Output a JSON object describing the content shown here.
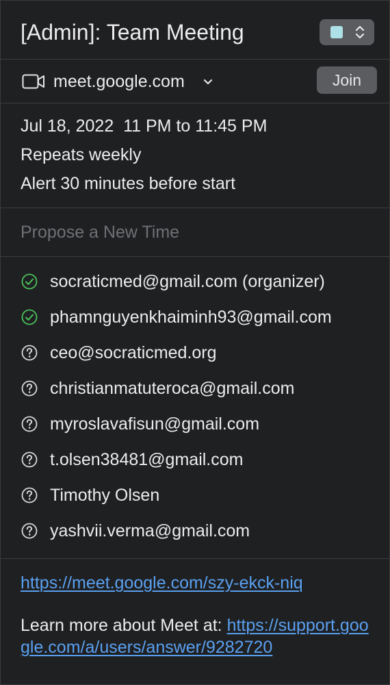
{
  "event": {
    "title": "[Admin]: Team Meeting",
    "calendar_color": "#aee0e7"
  },
  "conferencing": {
    "service_label": "meet.google.com",
    "join_label": "Join",
    "icon": "video-camera-icon"
  },
  "details": {
    "datetime": "Jul 18, 2022  11 PM to 11:45 PM",
    "recurrence": "Repeats weekly",
    "alert": "Alert 30 minutes before start"
  },
  "propose_placeholder": "Propose a New Time",
  "attendees": [
    {
      "name": "socraticmed@gmail.com (organizer)",
      "status": "accepted",
      "icon": "check-circle-icon"
    },
    {
      "name": "phamnguyenkhaiminh93@gmail.com",
      "status": "accepted",
      "icon": "check-circle-icon"
    },
    {
      "name": "ceo@socraticmed.org",
      "status": "unknown",
      "icon": "question-circle-icon"
    },
    {
      "name": "christianmatuteroca@gmail.com",
      "status": "unknown",
      "icon": "question-circle-icon"
    },
    {
      "name": "myroslavafisun@gmail.com",
      "status": "unknown",
      "icon": "question-circle-icon"
    },
    {
      "name": "t.olsen38481@gmail.com",
      "status": "unknown",
      "icon": "question-circle-icon"
    },
    {
      "name": "Timothy Olsen",
      "status": "unknown",
      "icon": "question-circle-icon"
    },
    {
      "name": "yashvii.verma@gmail.com",
      "status": "unknown",
      "icon": "question-circle-icon"
    }
  ],
  "notes": {
    "meet_link": "https://meet.google.com/szy-ekck-niq",
    "learn_more_prefix": "Learn more about Meet at: ",
    "learn_more_link": "https://support.google.com/a/users/answer/9282720"
  },
  "colors": {
    "background": "#1f2022",
    "accepted": "#4cc15a",
    "link": "#5aa0f0",
    "muted": "#6f7074"
  }
}
